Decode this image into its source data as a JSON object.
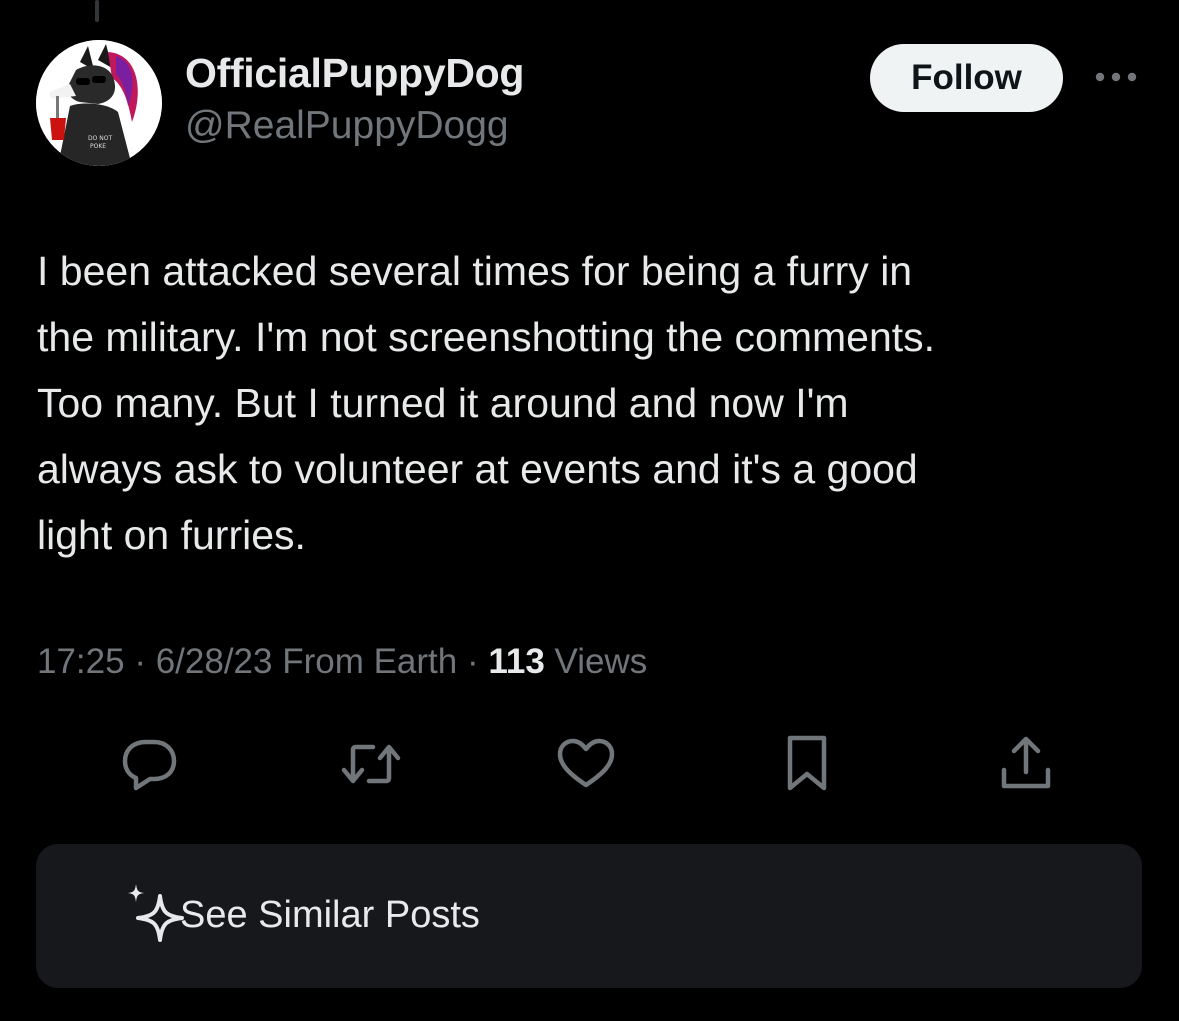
{
  "user": {
    "display_name": "OfficialPuppyDog",
    "handle": "@RealPuppyDogg",
    "avatar_text": "DO NOT POKE"
  },
  "follow_label": "Follow",
  "post": {
    "lines": [
      "I been attacked several times for being a furry in",
      "the military. I'm not screenshotting the comments.",
      "Too many. But I turned it around and now I'm",
      "always ask to volunteer at events and it's a good",
      "light on furries."
    ]
  },
  "meta": {
    "time": "17:25",
    "sep1": " · ",
    "date": "6/28/23",
    "from": " From Earth",
    "sep2": " · ",
    "views_count": "113",
    "views_label": " Views"
  },
  "actions": {
    "icons": [
      "reply-icon",
      "repost-icon",
      "like-icon",
      "bookmark-icon",
      "share-icon"
    ]
  },
  "similar": {
    "label": "See Similar Posts",
    "icon": "sparkle-icon"
  },
  "colors": {
    "background": "#000000",
    "text": "#e7e9ea",
    "secondary": "#71767b",
    "card": "#16181c",
    "button": "#eff3f4"
  }
}
